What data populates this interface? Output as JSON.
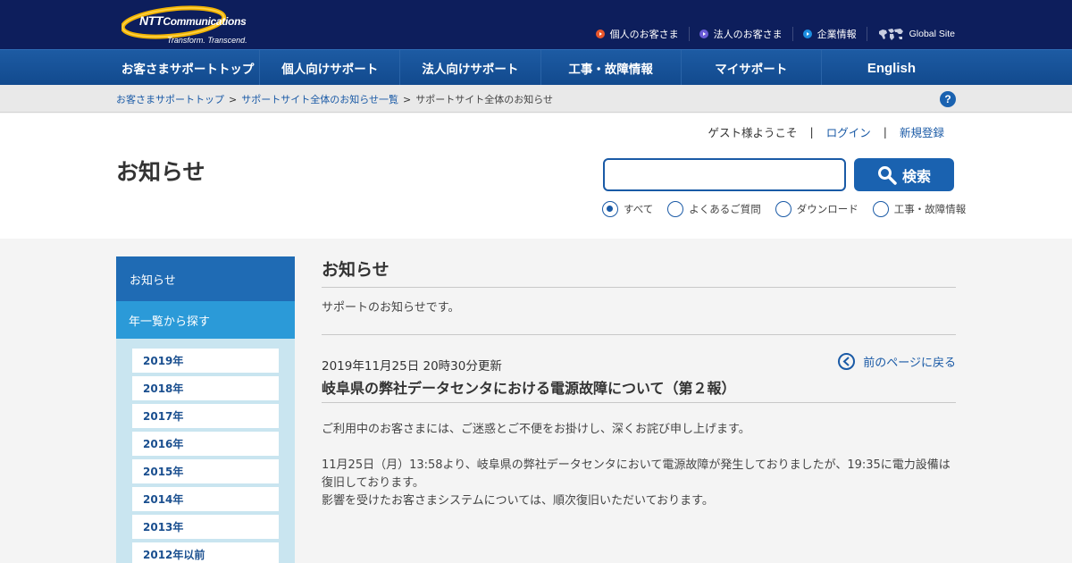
{
  "header": {
    "logo_brand": "NTT",
    "logo_brand_rest": "Communications",
    "logo_tagline": "Transform. Transcend.",
    "links": [
      {
        "label": "個人のお客さま",
        "icon": "arrow-circle-orange-icon"
      },
      {
        "label": "法人のお客さま",
        "icon": "arrow-circle-purple-icon"
      },
      {
        "label": "企業情報",
        "icon": "arrow-circle-blue-icon"
      },
      {
        "label": "Global Site",
        "icon": "world-map-icon"
      }
    ]
  },
  "nav": {
    "items": [
      "お客さまサポートトップ",
      "個人向けサポート",
      "法人向けサポート",
      "工事・故障情報",
      "マイサポート",
      "English"
    ]
  },
  "breadcrumb": {
    "items": [
      "お客さまサポートトップ",
      "サポートサイト全体のお知らせ一覧"
    ],
    "separator": ">",
    "current": "サポートサイト全体のお知らせ"
  },
  "user": {
    "welcome": "ゲスト様ようこそ",
    "separator": "|",
    "login": "ログイン",
    "register": "新規登録"
  },
  "page_title": "お知らせ",
  "search": {
    "value": "",
    "button_label": "検索",
    "options": [
      {
        "label": "すべて",
        "checked": true
      },
      {
        "label": "よくあるご質問",
        "checked": false
      },
      {
        "label": "ダウンロード",
        "checked": false
      },
      {
        "label": "工事・故障情報",
        "checked": false
      }
    ]
  },
  "sidebar": {
    "heading": "お知らせ",
    "subheading": "年一覧から探す",
    "years": [
      "2019年",
      "2018年",
      "2017年",
      "2016年",
      "2015年",
      "2014年",
      "2013年",
      "2012年以前"
    ]
  },
  "main": {
    "title": "お知らせ",
    "description": "サポートのお知らせです。",
    "back_label": "前のページに戻る",
    "news": {
      "date": "2019年11月25日 20時30分更新",
      "title": "岐阜県の弊社データセンタにおける電源故障について（第２報）",
      "paragraphs": [
        "ご利用中のお客さまには、ご迷惑とご不便をお掛けし、深くお詫び申し上げます。",
        "11月25日（月）13:58より、岐阜県の弊社データセンタにおいて電源故障が発生しておりましたが、19:35に電力設備は復旧しております。",
        "影響を受けたお客さまシステムについては、順次復旧いただいております。"
      ]
    }
  },
  "colors": {
    "header_bg": "#0d1e5c",
    "nav_bg": "#1d5ba3",
    "link": "#1a5aa6",
    "sidebar_head": "#1f6bb4",
    "sidebar_sub": "#2b9ad8",
    "year_box": "#c9e5f0",
    "logo_swoosh": "#f2b300"
  }
}
